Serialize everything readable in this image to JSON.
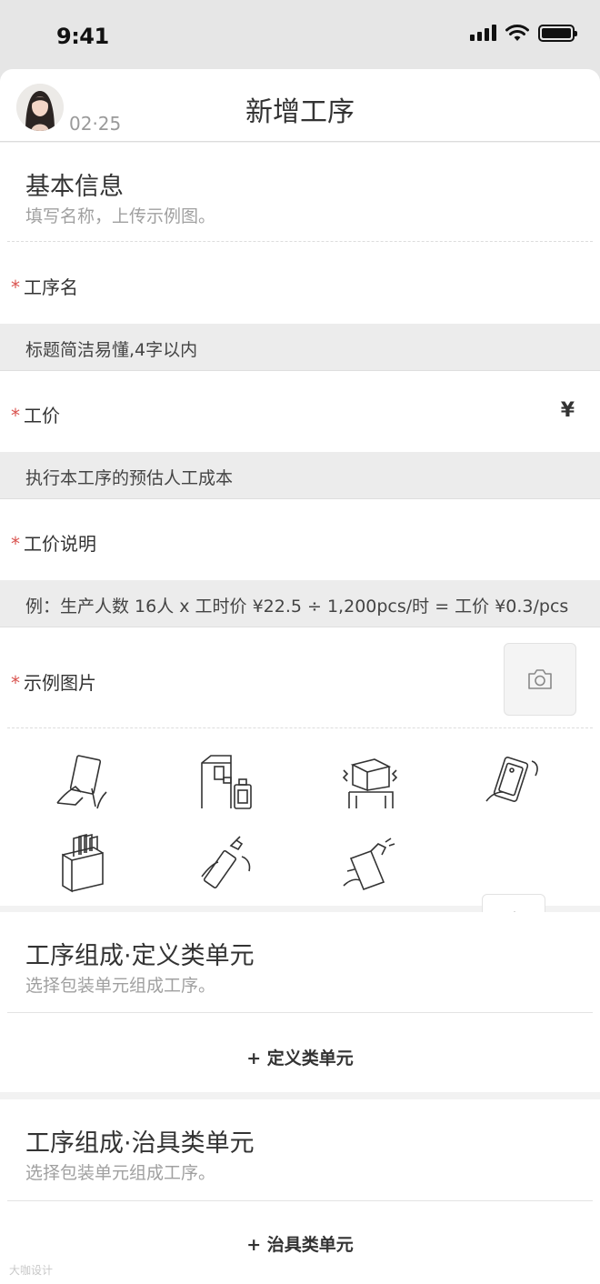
{
  "status_bar": {
    "time": "9:41"
  },
  "header": {
    "timestamp": "02·25",
    "title": "新增工序"
  },
  "basic_info": {
    "title": "基本信息",
    "subtitle": "填写名称，上传示例图。"
  },
  "fields": {
    "name": {
      "required_mark": "*",
      "label": "工序名",
      "hint": "标题简洁易懂,4字以内"
    },
    "price": {
      "required_mark": "*",
      "label": "工价",
      "currency": "¥",
      "hint": "执行本工序的预估人工成本"
    },
    "price_note": {
      "required_mark": "*",
      "label": "工价说明",
      "hint": "例：生产人数 16人 x 工时价 ¥22.5 ÷ 1,200pcs/时 = 工价 ¥0.3/pcs"
    },
    "images": {
      "required_mark": "*",
      "label": "示例图片"
    }
  },
  "icons": {
    "camera": "camera-icon",
    "thumbnails": [
      "hands-card-icon",
      "machine-bottle-icon",
      "box-on-stand-icon",
      "hand-phone-case-icon",
      "card-rack-icon",
      "hand-spray-bottle-icon",
      "hand-spray-package-icon"
    ],
    "add": "plus-icon"
  },
  "define_units": {
    "title": "工序组成·定义类单元",
    "subtitle": "选择包装单元组成工序。",
    "add_label": "+ 定义类单元"
  },
  "fixture_units": {
    "title": "工序组成·治具类单元",
    "subtitle": "选择包装单元组成工序。",
    "add_label": "+ 治具类单元"
  },
  "watermark": "大咖设计"
}
